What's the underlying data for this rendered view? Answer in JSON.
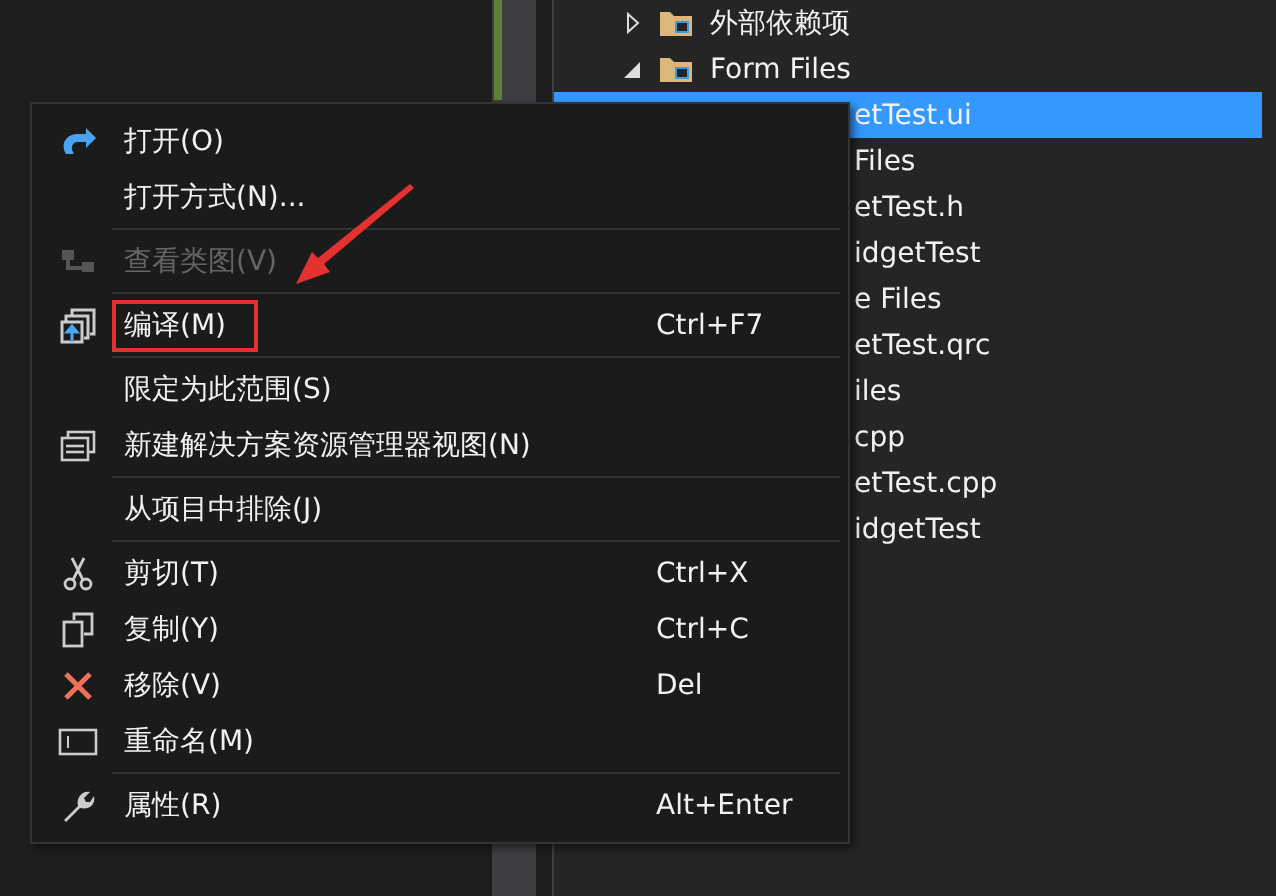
{
  "solution_explorer": {
    "items": [
      {
        "kind": "node",
        "label": "外部依赖项",
        "expanded": false,
        "selected": false
      },
      {
        "kind": "node",
        "label": "Form Files",
        "expanded": true,
        "selected": false,
        "children": [
          {
            "kind": "partial",
            "label": "etTest.ui",
            "selected": true
          }
        ]
      },
      {
        "kind": "partial",
        "label": "Files",
        "selected": false
      },
      {
        "kind": "partial",
        "label": "etTest.h",
        "selected": false
      },
      {
        "kind": "partial",
        "label": "idgetTest",
        "selected": false
      },
      {
        "kind": "partial",
        "label": "e Files",
        "selected": false
      },
      {
        "kind": "partial",
        "label": "etTest.qrc",
        "selected": false
      },
      {
        "kind": "partial",
        "label": "iles",
        "selected": false
      },
      {
        "kind": "partial",
        "label": "cpp",
        "selected": false
      },
      {
        "kind": "partial",
        "label": "etTest.cpp",
        "selected": false
      },
      {
        "kind": "partial",
        "label": "idgetTest",
        "selected": false
      }
    ]
  },
  "context_menu": {
    "items": [
      {
        "kind": "item",
        "label": "打开(O)",
        "disabled": false,
        "annotated": false
      },
      {
        "kind": "item",
        "label": "打开方式(N)...",
        "disabled": false,
        "annotated": false
      },
      {
        "kind": "separator"
      },
      {
        "kind": "item",
        "label": "查看类图(V)",
        "disabled": true,
        "annotated": false
      },
      {
        "kind": "separator"
      },
      {
        "kind": "item",
        "label": "编译(M)",
        "shortcut": "Ctrl+F7",
        "disabled": false,
        "annotated": true
      },
      {
        "kind": "separator"
      },
      {
        "kind": "item",
        "label": "限定为此范围(S)",
        "disabled": false,
        "annotated": false
      },
      {
        "kind": "item",
        "label": "新建解决方案资源管理器视图(N)",
        "disabled": false,
        "annotated": false
      },
      {
        "kind": "separator"
      },
      {
        "kind": "item",
        "label": "从项目中排除(J)",
        "disabled": false,
        "annotated": false
      },
      {
        "kind": "separator"
      },
      {
        "kind": "item",
        "label": "剪切(T)",
        "shortcut": "Ctrl+X",
        "disabled": false,
        "annotated": false
      },
      {
        "kind": "item",
        "label": "复制(Y)",
        "shortcut": "Ctrl+C",
        "disabled": false,
        "annotated": false
      },
      {
        "kind": "item",
        "label": "移除(V)",
        "shortcut": "Del",
        "disabled": false,
        "annotated": false
      },
      {
        "kind": "item",
        "label": "重命名(M)",
        "disabled": false,
        "annotated": false
      },
      {
        "kind": "separator"
      },
      {
        "kind": "item",
        "label": "属性(R)",
        "shortcut": "Alt+Enter",
        "disabled": false,
        "annotated": false
      }
    ]
  }
}
